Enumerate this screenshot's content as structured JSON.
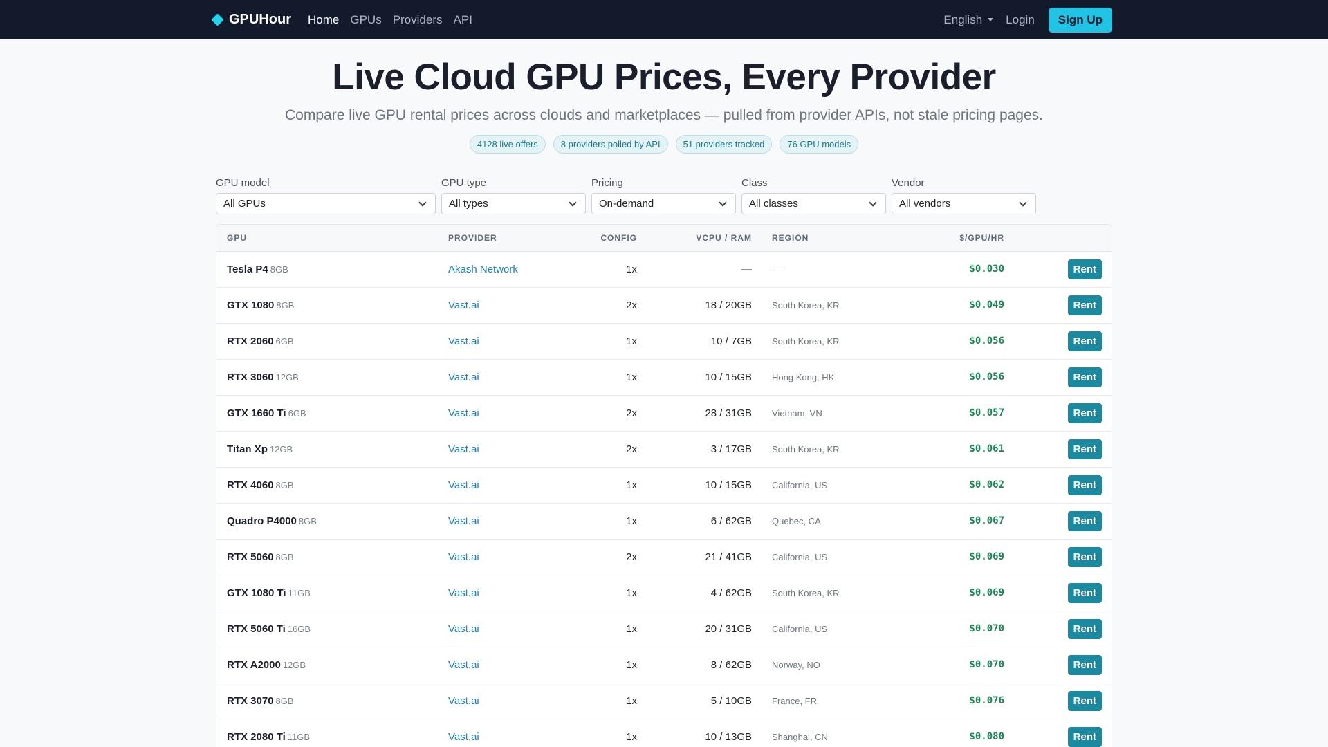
{
  "nav": {
    "brand": "GPUHour",
    "links": [
      "Home",
      "GPUs",
      "Providers",
      "API"
    ],
    "language": "English",
    "login": "Login",
    "signup": "Sign Up"
  },
  "hero": {
    "title": "Live Cloud GPU Prices, Every Provider",
    "subtitle": "Compare live GPU rental prices across clouds and marketplaces — pulled from provider APIs, not stale pricing pages.",
    "pills": [
      "4128 live offers",
      "8 providers polled by API",
      "51 providers tracked",
      "76 GPU models"
    ]
  },
  "filters": [
    {
      "label": "GPU model",
      "value": "All GPUs"
    },
    {
      "label": "GPU type",
      "value": "All types"
    },
    {
      "label": "Pricing",
      "value": "On-demand"
    },
    {
      "label": "Class",
      "value": "All classes"
    },
    {
      "label": "Vendor",
      "value": "All vendors"
    }
  ],
  "table": {
    "headers": [
      "GPU",
      "Provider",
      "Config",
      "vCPU / RAM",
      "Region",
      "$/GPU/hr",
      ""
    ],
    "rent_label": "Rent",
    "rows": [
      {
        "gpu": "Tesla P4",
        "mem": "8GB",
        "provider": "Akash Network",
        "config": "1x",
        "vcpu": "—",
        "region": "—",
        "price": "$0.030"
      },
      {
        "gpu": "GTX 1080",
        "mem": "8GB",
        "provider": "Vast.ai",
        "config": "2x",
        "vcpu": "18 / 20GB",
        "region": "South Korea, KR",
        "price": "$0.049"
      },
      {
        "gpu": "RTX 2060",
        "mem": "6GB",
        "provider": "Vast.ai",
        "config": "1x",
        "vcpu": "10 / 7GB",
        "region": "South Korea, KR",
        "price": "$0.056"
      },
      {
        "gpu": "RTX 3060",
        "mem": "12GB",
        "provider": "Vast.ai",
        "config": "1x",
        "vcpu": "10 / 15GB",
        "region": "Hong Kong, HK",
        "price": "$0.056"
      },
      {
        "gpu": "GTX 1660 Ti",
        "mem": "6GB",
        "provider": "Vast.ai",
        "config": "2x",
        "vcpu": "28 / 31GB",
        "region": "Vietnam, VN",
        "price": "$0.057"
      },
      {
        "gpu": "Titan Xp",
        "mem": "12GB",
        "provider": "Vast.ai",
        "config": "2x",
        "vcpu": "3 / 17GB",
        "region": "South Korea, KR",
        "price": "$0.061"
      },
      {
        "gpu": "RTX 4060",
        "mem": "8GB",
        "provider": "Vast.ai",
        "config": "1x",
        "vcpu": "10 / 15GB",
        "region": "California, US",
        "price": "$0.062"
      },
      {
        "gpu": "Quadro P4000",
        "mem": "8GB",
        "provider": "Vast.ai",
        "config": "1x",
        "vcpu": "6 / 62GB",
        "region": "Quebec, CA",
        "price": "$0.067"
      },
      {
        "gpu": "RTX 5060",
        "mem": "8GB",
        "provider": "Vast.ai",
        "config": "2x",
        "vcpu": "21 / 41GB",
        "region": "California, US",
        "price": "$0.069"
      },
      {
        "gpu": "GTX 1080 Ti",
        "mem": "11GB",
        "provider": "Vast.ai",
        "config": "1x",
        "vcpu": "4 / 62GB",
        "region": "South Korea, KR",
        "price": "$0.069"
      },
      {
        "gpu": "RTX 5060 Ti",
        "mem": "16GB",
        "provider": "Vast.ai",
        "config": "1x",
        "vcpu": "20 / 31GB",
        "region": "California, US",
        "price": "$0.070"
      },
      {
        "gpu": "RTX A2000",
        "mem": "12GB",
        "provider": "Vast.ai",
        "config": "1x",
        "vcpu": "8 / 62GB",
        "region": "Norway, NO",
        "price": "$0.070"
      },
      {
        "gpu": "RTX 3070",
        "mem": "8GB",
        "provider": "Vast.ai",
        "config": "1x",
        "vcpu": "5 / 10GB",
        "region": "France, FR",
        "price": "$0.076"
      },
      {
        "gpu": "RTX 2080 Ti",
        "mem": "11GB",
        "provider": "Vast.ai",
        "config": "1x",
        "vcpu": "10 / 13GB",
        "region": "Shanghai, CN",
        "price": "$0.080"
      }
    ]
  },
  "colors": {
    "nav_bg": "#121a2b",
    "accent": "#22c4e6",
    "price": "#198754",
    "rent": "#1b8aa0"
  }
}
